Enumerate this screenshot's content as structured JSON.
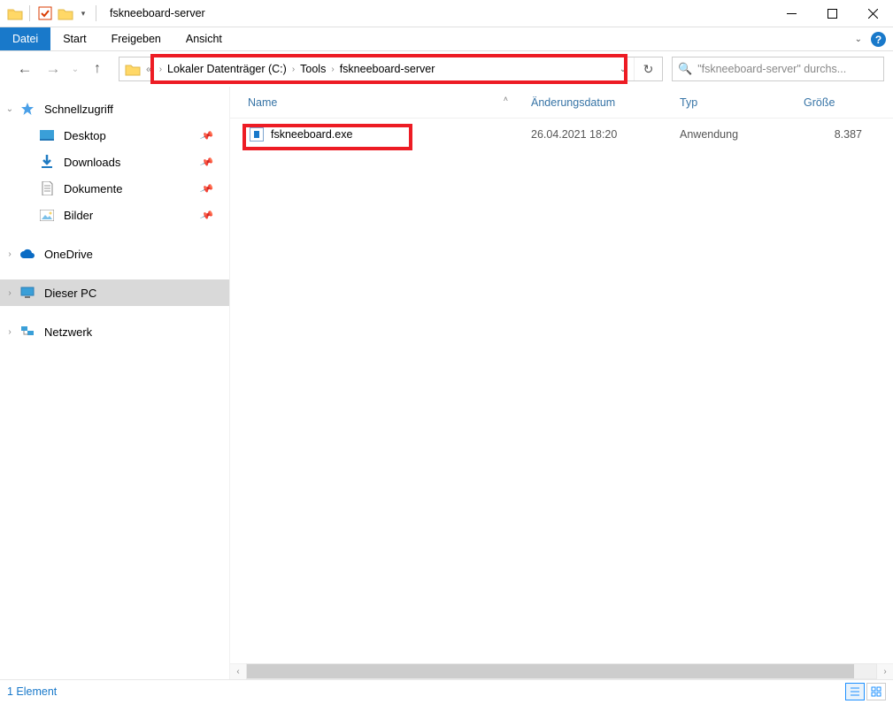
{
  "window": {
    "title": "fskneeboard-server"
  },
  "ribbon": {
    "file": "Datei",
    "start": "Start",
    "share": "Freigeben",
    "view": "Ansicht"
  },
  "breadcrumb": {
    "segments": [
      "Lokaler Datenträger (C:)",
      "Tools",
      "fskneeboard-server"
    ]
  },
  "search": {
    "placeholder": "\"fskneeboard-server\" durchs..."
  },
  "sidebar": {
    "quickaccess": "Schnellzugriff",
    "desktop": "Desktop",
    "downloads": "Downloads",
    "documents": "Dokumente",
    "pictures": "Bilder",
    "onedrive": "OneDrive",
    "thispc": "Dieser PC",
    "network": "Netzwerk"
  },
  "columns": {
    "name": "Name",
    "date": "Änderungsdatum",
    "type": "Typ",
    "size": "Größe"
  },
  "files": [
    {
      "name": "fskneeboard.exe",
      "date": "26.04.2021 18:20",
      "type": "Anwendung",
      "size": "8.387"
    }
  ],
  "status": {
    "count": "1 Element"
  }
}
